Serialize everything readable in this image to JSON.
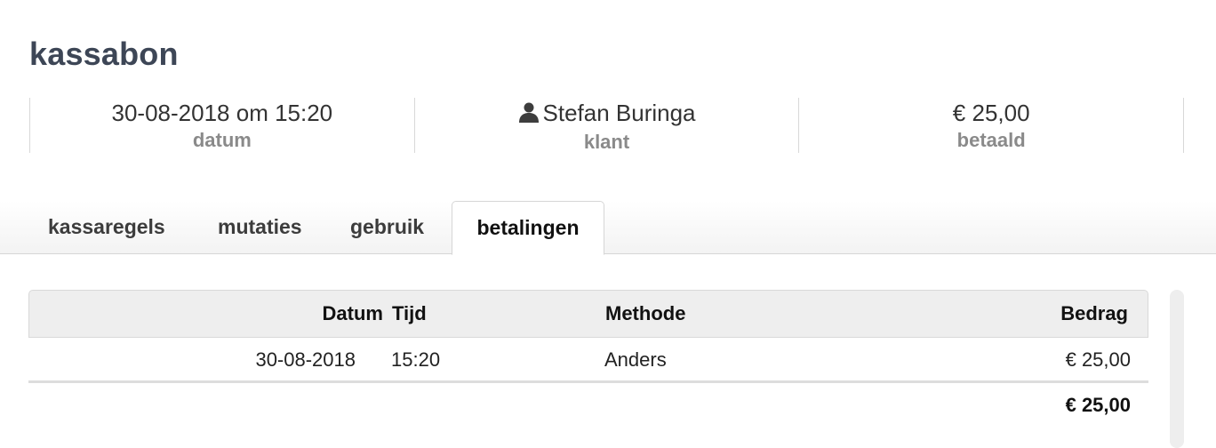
{
  "page": {
    "title": "kassabon"
  },
  "summary": {
    "date": {
      "value": "30-08-2018 om 15:20",
      "label": "datum"
    },
    "customer": {
      "value": "Stefan Buringa",
      "label": "klant",
      "icon": "person-icon"
    },
    "paid": {
      "value": "€ 25,00",
      "label": "betaald"
    }
  },
  "tabs": [
    {
      "label": "kassaregels"
    },
    {
      "label": "mutaties"
    },
    {
      "label": "gebruik"
    },
    {
      "label": "betalingen",
      "active": true
    }
  ],
  "payments": {
    "columns": {
      "datum": "Datum",
      "tijd": "Tijd",
      "methode": "Methode",
      "bedrag": "Bedrag"
    },
    "rows": [
      {
        "datum": "30-08-2018",
        "tijd": "15:20",
        "methode": "Anders",
        "bedrag": "€ 25,00"
      }
    ],
    "total": "€ 25,00"
  },
  "colors": {
    "title": "#3d4656",
    "label": "#8a8a8a",
    "header_bg": "#eeeeee"
  }
}
